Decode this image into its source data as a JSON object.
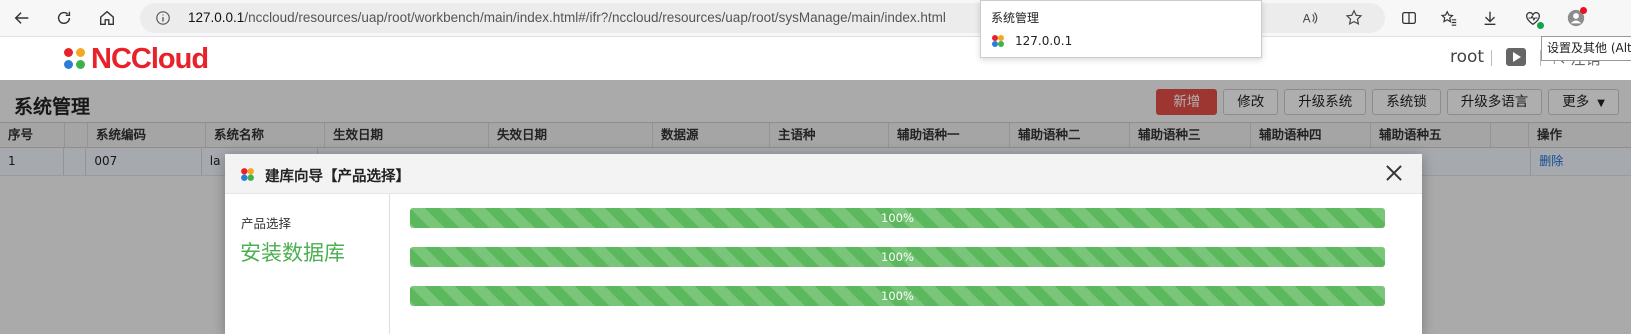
{
  "browser": {
    "url_host": "127.0.0.1",
    "url_path": "/nccloud/resources/uap/root/workbench/main/index.html#/ifr?/nccloud/resources/uap/root/sysManage/main/index.html",
    "tab_tooltip": {
      "title": "系统管理",
      "host": "127.0.0.1"
    },
    "settings_tooltip": "设置及其他 (Alt+F)",
    "icons": [
      "back-icon",
      "refresh-icon",
      "home-icon",
      "info-icon",
      "read-aloud-icon",
      "favorite-star-icon",
      "split-screen-icon",
      "favorites-icon",
      "downloads-icon",
      "browser-essentials-icon",
      "profile-icon"
    ]
  },
  "app": {
    "logo_text": "NCCloud",
    "user": "root",
    "logout": "注销",
    "brand_color": "#e8222a"
  },
  "page": {
    "title": "系统管理",
    "actions": {
      "add": "新增",
      "edit": "修改",
      "upgrade": "升级系统",
      "lock": "系统锁",
      "upgrade_lang": "升级多语言",
      "more": "更多"
    },
    "table": {
      "columns": [
        "序号",
        "",
        "系统编码",
        "系统名称",
        "生效日期",
        "失效日期",
        "数据源",
        "主语种",
        "辅助语种一",
        "辅助语种二",
        "辅助语种三",
        "辅助语种四",
        "辅助语种五",
        "",
        "操作"
      ],
      "rows": [
        {
          "index": "1",
          "code": "007",
          "name": "la",
          "action": "删除"
        }
      ]
    }
  },
  "modal": {
    "title": "建库向导【产品选择】",
    "step_label": "产品选择",
    "current_step": "安装数据库",
    "progress": [
      {
        "value": 1.0,
        "label": "100%"
      },
      {
        "value": 1.0,
        "label": "100%"
      },
      {
        "value": 1.0,
        "label": "100%"
      }
    ],
    "progress_color": "#5cb85c"
  }
}
